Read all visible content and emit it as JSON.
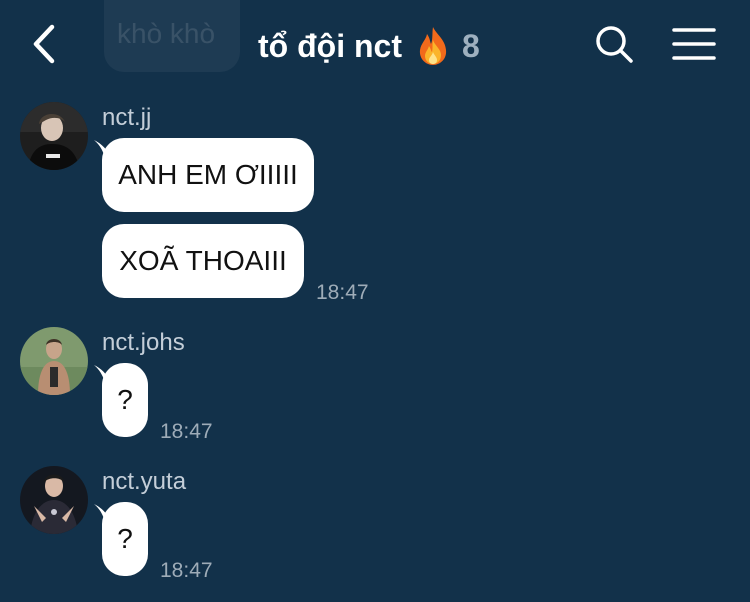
{
  "header": {
    "previous_message_preview": "khò khò",
    "title": "tổ đội nct",
    "member_count": "8",
    "back_icon": "chevron-left-icon",
    "title_icon": "fire-emoji-icon",
    "search_icon": "search-icon",
    "menu_icon": "hamburger-menu-icon"
  },
  "messages": [
    {
      "sender": "nct.jj",
      "bubbles": [
        {
          "text": "ANH EM ƠIIIII"
        },
        {
          "text": "XOÃ THOAIII"
        }
      ],
      "time": "18:47"
    },
    {
      "sender": "nct.johs",
      "bubbles": [
        {
          "text": "?"
        }
      ],
      "time": "18:47"
    },
    {
      "sender": "nct.yuta",
      "bubbles": [
        {
          "text": "?"
        }
      ],
      "time": "18:47"
    }
  ],
  "colors": {
    "background": "#12314a",
    "bubble": "#ffffff",
    "sender_name": "#c4ced8",
    "timestamp": "#9eacb8",
    "member_count": "#9eb0bf"
  }
}
